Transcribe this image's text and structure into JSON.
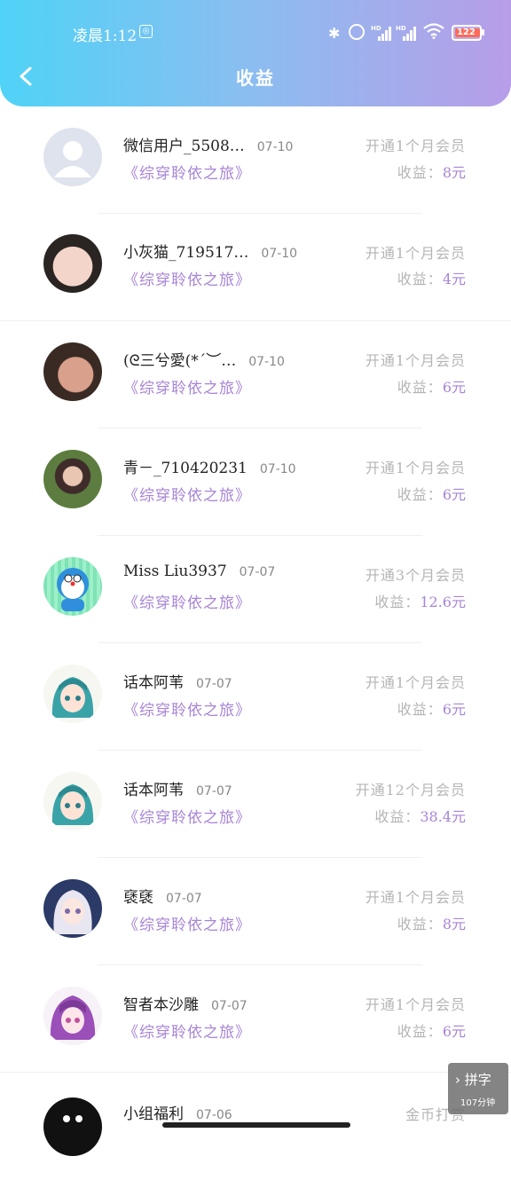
{
  "status_bar": {
    "time": "凌晨1:12",
    "battery": "122"
  },
  "header": {
    "title": "收益"
  },
  "rows": [
    {
      "name": "微信用户_5508…",
      "date": "07-10",
      "book": "《综穿聆依之旅》",
      "plan": "开通1个月会员",
      "earn_label": "收益：",
      "earn_amount": "8元",
      "avatar": "default-user"
    },
    {
      "name": "小灰猫_719517…",
      "date": "07-10",
      "book": "《综穿聆依之旅》",
      "plan": "开通1个月会员",
      "earn_label": "收益：",
      "earn_amount": "4元",
      "avatar": "photo"
    },
    {
      "name": "(ᘓ三兮愛(*ˊ︶…",
      "date": "07-10",
      "book": "《综穿聆依之旅》",
      "plan": "开通1个月会员",
      "earn_label": "收益：",
      "earn_amount": "6元",
      "avatar": "photo"
    },
    {
      "name": "青－_710420231",
      "date": "07-10",
      "book": "《综穿聆依之旅》",
      "plan": "开通1个月会员",
      "earn_label": "收益：",
      "earn_amount": "6元",
      "avatar": "photo"
    },
    {
      "name": "Miss Liu3937",
      "date": "07-07",
      "book": "《综穿聆依之旅》",
      "plan": "开通3个月会员",
      "earn_label": "收益：",
      "earn_amount": "12.6元",
      "avatar": "doraemon"
    },
    {
      "name": "话本阿苇",
      "date": "07-07",
      "book": "《综穿聆依之旅》",
      "plan": "开通1个月会员",
      "earn_label": "收益：",
      "earn_amount": "6元",
      "avatar": "anime-teal"
    },
    {
      "name": "话本阿苇",
      "date": "07-07",
      "book": "《综穿聆依之旅》",
      "plan": "开通12个月会员",
      "earn_label": "收益：",
      "earn_amount": "38.4元",
      "avatar": "anime-teal"
    },
    {
      "name": "褎褎",
      "date": "07-07",
      "book": "《综穿聆依之旅》",
      "plan": "开通1个月会员",
      "earn_label": "收益：",
      "earn_amount": "8元",
      "avatar": "anime-white"
    },
    {
      "name": "智者本沙雕",
      "date": "07-07",
      "book": "《综穿聆依之旅》",
      "plan": "开通1个月会员",
      "earn_label": "收益：",
      "earn_amount": "6元",
      "avatar": "anime-purple"
    },
    {
      "name": "小组福利",
      "date": "07-06",
      "book": "",
      "plan": "金币打赏",
      "earn_label": "",
      "earn_amount": "",
      "avatar": "black"
    }
  ],
  "floating": {
    "label": "拼字",
    "sub": "107分钟"
  }
}
